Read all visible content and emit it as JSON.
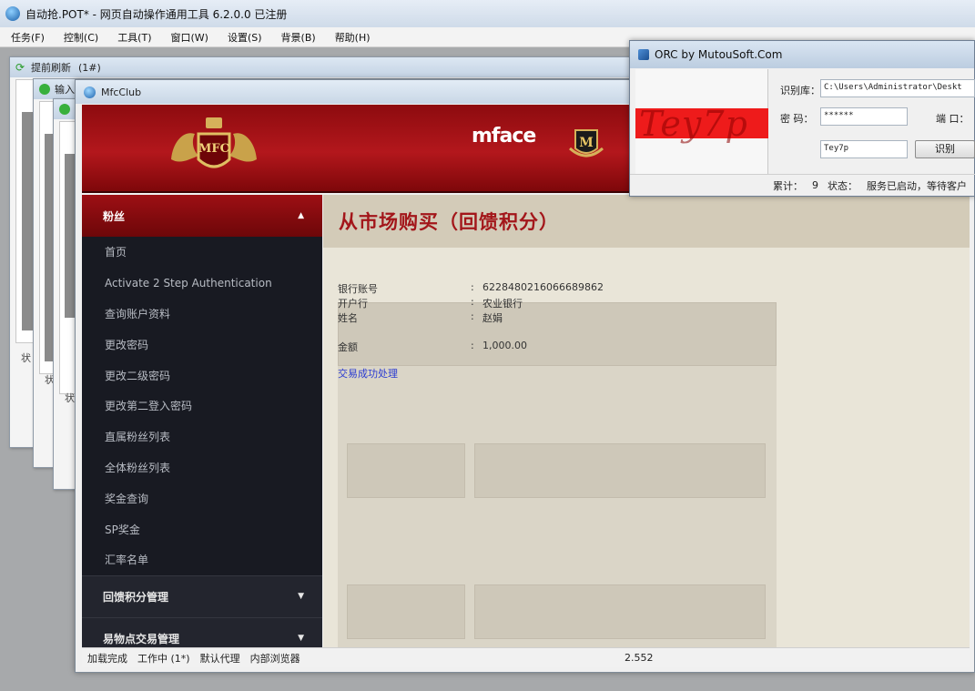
{
  "app": {
    "title": "自动抢.POT* - 网页自动操作通用工具 6.2.0.0  已注册",
    "menu": [
      "任务(F)",
      "控制(C)",
      "工具(T)",
      "窗口(W)",
      "设置(S)",
      "背景(B)",
      "帮助(H)"
    ]
  },
  "child_windows": {
    "refresh_title": "提前刷新",
    "refresh_index": "(1#)",
    "second_title": "输入"
  },
  "mfc_window": {
    "title": "MfcClub",
    "banner": {
      "emblem_text": "MFC",
      "mface_logo": "mface",
      "m_logo": "M"
    },
    "sidebar": {
      "header": "粉丝",
      "items": [
        "首页",
        "Activate 2 Step Authentication",
        "查询账户资料",
        "更改密码",
        "更改二级密码",
        "更改第二登入密码",
        "直属粉丝列表",
        "全体粉丝列表",
        "奖金查询",
        "SP奖金",
        "汇率名单"
      ],
      "groups": [
        "回馈积分管理",
        "易物点交易管理"
      ]
    },
    "content": {
      "page_title": "从市场购买（回馈积分）",
      "fields": [
        {
          "label": "银行账号",
          "value": "6228480216066689862"
        },
        {
          "label": "开户行",
          "value": "农业银行"
        },
        {
          "label": "姓名",
          "value": "赵娟"
        },
        {
          "label": "金额",
          "value": "1,000.00"
        }
      ],
      "link": "交易成功处理"
    },
    "statusbar": {
      "items": [
        "加载完成",
        "工作中 (1*)",
        "默认代理",
        "内部浏览器"
      ],
      "value": "2.552"
    }
  },
  "orc_dialog": {
    "title": "ORC by MutouSoft.Com",
    "captcha_text": "Tey7p",
    "library_label": "识别库：",
    "library_path": "C:\\Users\\Administrator\\Deskt",
    "password_label": "密  码：",
    "password_value": "******",
    "port_label": "端  口：",
    "result_value": "Tey7p",
    "recognize_button": "识别",
    "status": {
      "count_label": "累计：",
      "count_value": "9",
      "state_label": "状态：",
      "state_value": "服务已启动，等待客户"
    }
  }
}
